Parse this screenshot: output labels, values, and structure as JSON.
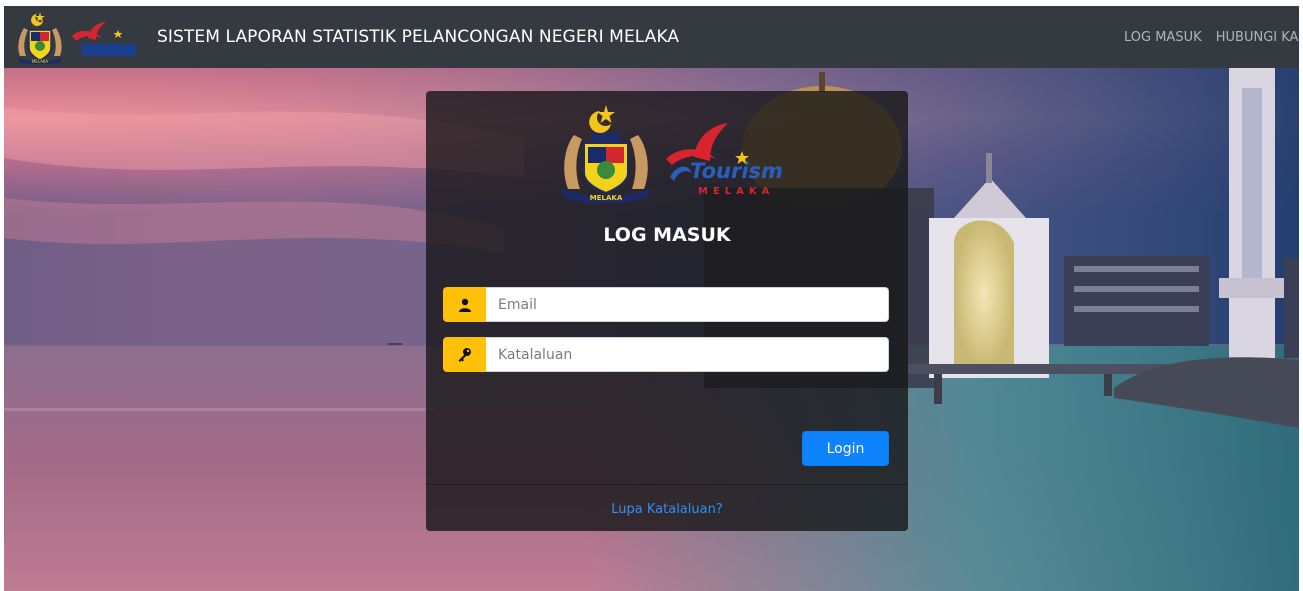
{
  "navbar": {
    "logo_text": "MELAKA",
    "title": "SISTEM LAPORAN STATISTIK PELANCONGAN NEGERI MELAKA",
    "links": [
      "LOG MASUK",
      "HUBUNGI KAMI"
    ]
  },
  "login": {
    "logo": {
      "brand": "Tourism",
      "sub": "MELAKA",
      "crest_ribbon": "MELAKA"
    },
    "title": "LOG MASUK",
    "email_placeholder": "Email",
    "password_placeholder": "Katalaluan",
    "button_label": "Login",
    "forgot_link": "Lupa Katalaluan?"
  },
  "colors": {
    "navbar_bg": "#343a40",
    "accent_yellow": "#ffc107",
    "button_blue": "#0d83fd",
    "link_blue": "#2f8ff7",
    "sky_pink": "#e98a9a",
    "sea_teal": "#3f8f97"
  },
  "icons": {
    "email_addon": "user-icon",
    "password_addon": "key-icon"
  }
}
